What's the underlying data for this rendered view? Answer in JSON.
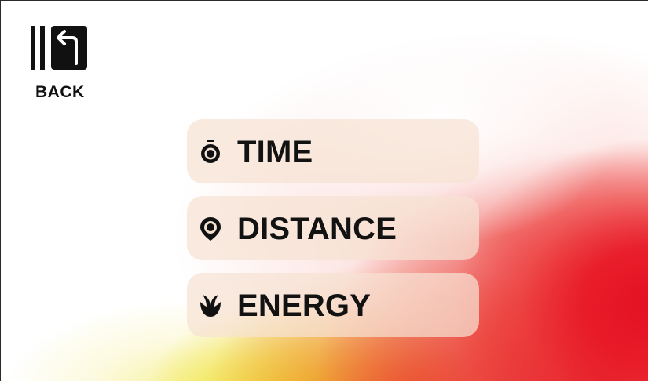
{
  "back": {
    "label": "BACK",
    "icon": "back-arrow-icon"
  },
  "menu": {
    "items": [
      {
        "label": "TIME",
        "icon": "stopwatch-icon"
      },
      {
        "label": "DISTANCE",
        "icon": "location-pin-icon"
      },
      {
        "label": "ENERGY",
        "icon": "flame-icon"
      }
    ]
  },
  "colors": {
    "background": "#ffffff",
    "text": "#121212",
    "button_fill": "#f6e2d2",
    "accent_red": "#e41022",
    "accent_yellow": "#ecdc1e"
  }
}
